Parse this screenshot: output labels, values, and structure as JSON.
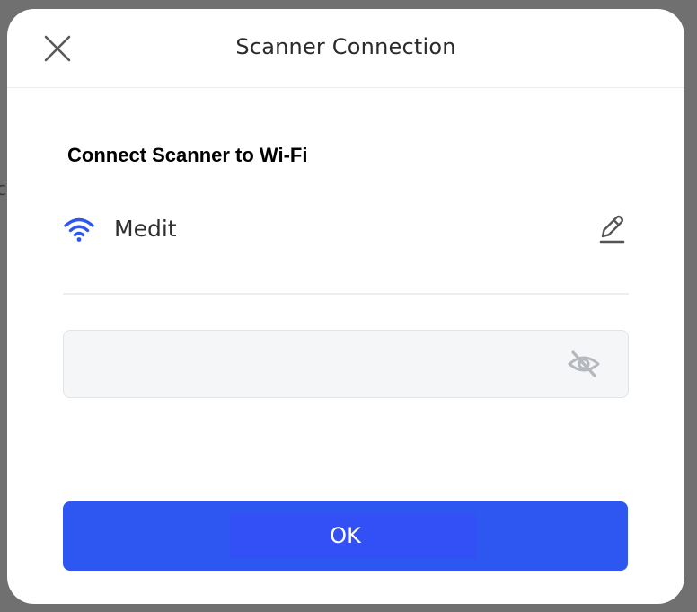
{
  "background": {
    "partial_text": "c"
  },
  "dialog": {
    "title": "Scanner Connection",
    "close_icon": "close-icon",
    "section_title": "Connect Scanner to Wi-Fi",
    "network": {
      "icon": "wifi-icon",
      "name": "Medit",
      "edit_icon": "pencil-icon"
    },
    "password": {
      "value": "",
      "placeholder": "",
      "visibility_icon": "eye-off-icon"
    },
    "ok_label": "OK"
  },
  "colors": {
    "accent": "#2e56f0",
    "wifi": "#2e56f0",
    "overlay": "#707070"
  }
}
